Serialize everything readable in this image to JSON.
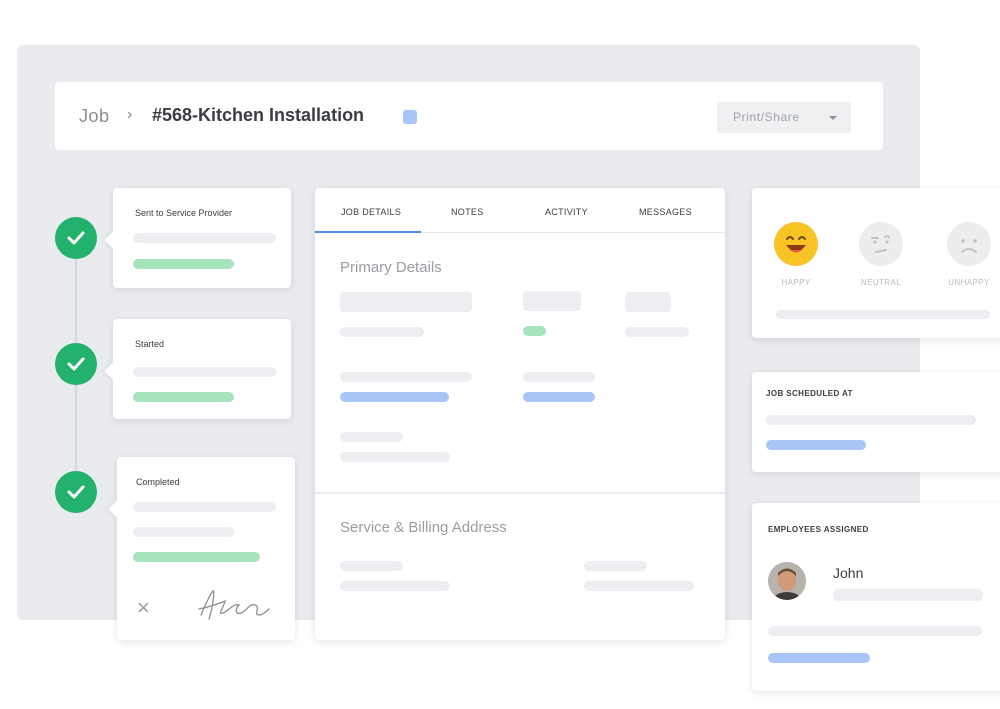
{
  "header": {
    "breadcrumb_root": "Job",
    "breadcrumb_separator": "›",
    "job_title": "#568-Kitchen Installation",
    "print_share_label": "Print/Share"
  },
  "timeline": {
    "steps": [
      {
        "label": "Sent to Service Provider",
        "status": "complete"
      },
      {
        "label": "Started",
        "status": "complete"
      },
      {
        "label": "Completed",
        "status": "complete"
      }
    ],
    "completed_actions": {
      "reject_icon": "close-icon",
      "signature_icon": "signature-icon"
    }
  },
  "details": {
    "tabs": [
      {
        "label": "JOB DETAILS",
        "active": true
      },
      {
        "label": "NOTES",
        "active": false
      },
      {
        "label": "ACTIVITY",
        "active": false
      },
      {
        "label": "MESSAGES",
        "active": false
      }
    ],
    "primary_title": "Primary Details",
    "address_title": "Service & Billing Address"
  },
  "feedback": {
    "options": [
      {
        "label": "HAPPY",
        "icon": "happy-face-icon"
      },
      {
        "label": "NEUTRAL",
        "icon": "neutral-face-icon"
      },
      {
        "label": "UNHAPPY",
        "icon": "unhappy-face-icon"
      }
    ]
  },
  "schedule": {
    "heading": "JOB SCHEDULED AT"
  },
  "employees": {
    "heading": "EMPLOYEES ASSIGNED",
    "list": [
      {
        "name": "John"
      }
    ]
  },
  "colors": {
    "accent_blue": "#4a90e2",
    "success_green": "#23b26d",
    "skeleton_gray": "#eceef1",
    "skeleton_green": "#a7e3bd",
    "skeleton_blue": "#a7c6f7",
    "happy_yellow": "#f7c325"
  }
}
